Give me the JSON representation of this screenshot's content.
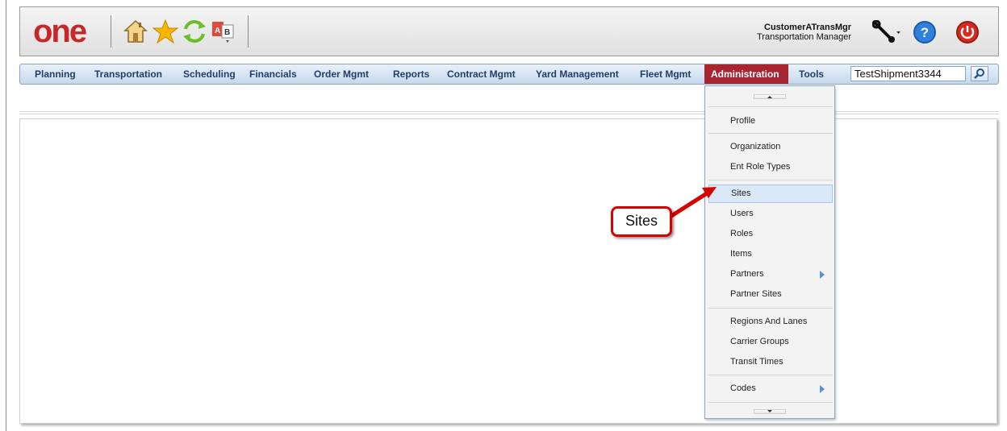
{
  "app": {
    "logo_text": "one",
    "accent_color": "#a72430",
    "logo_color": "#c62828"
  },
  "quick_icons": [
    "home-icon",
    "favorites-star-icon",
    "refresh-icon",
    "spell-check-icon"
  ],
  "user": {
    "name": "CustomerATransMgr",
    "role": "Transportation Manager"
  },
  "header_icons": [
    "wrench-icon",
    "help-icon",
    "power-icon"
  ],
  "nav": {
    "items": [
      "Planning",
      "Transportation",
      "Scheduling",
      "Financials",
      "Order Mgmt",
      "Reports",
      "Contract Mgmt",
      "Yard Management",
      "Fleet Mgmt",
      "Administration",
      "Tools"
    ],
    "active": "Administration"
  },
  "search": {
    "value": "TestShipment3344",
    "icon": "search-icon"
  },
  "admin_menu": {
    "items": [
      {
        "label": "Profile"
      },
      {
        "label": "Organization"
      },
      {
        "label": "Ent Role Types"
      },
      {
        "label": "Sites",
        "selected": true
      },
      {
        "label": "Users"
      },
      {
        "label": "Roles"
      },
      {
        "label": "Items"
      },
      {
        "label": "Partners",
        "submenu": true
      },
      {
        "label": "Partner Sites"
      },
      {
        "label": "Regions And Lanes"
      },
      {
        "label": "Carrier Groups"
      },
      {
        "label": "Transit Times"
      },
      {
        "label": "Codes",
        "submenu": true
      }
    ]
  },
  "callout": {
    "text": "Sites",
    "color": "#d80000"
  }
}
